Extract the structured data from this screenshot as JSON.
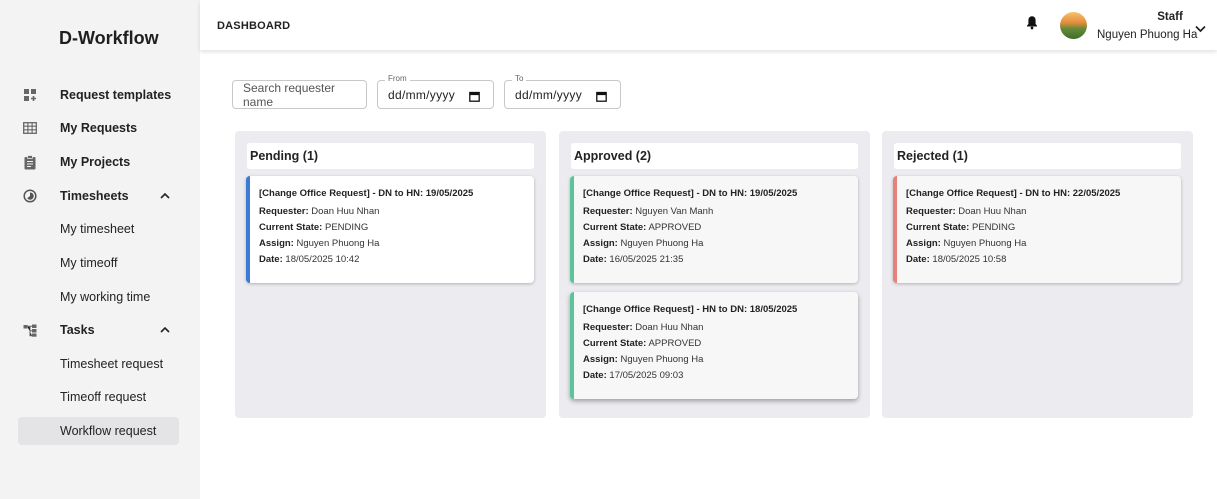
{
  "sidebar": {
    "brand": "D-Workflow",
    "items": [
      {
        "label": "Request templates"
      },
      {
        "label": "My Requests"
      },
      {
        "label": "My Projects"
      },
      {
        "label": "Timesheets"
      },
      {
        "label": "My timesheet"
      },
      {
        "label": "My timeoff"
      },
      {
        "label": "My working time"
      },
      {
        "label": "Tasks"
      },
      {
        "label": "Timesheet request"
      },
      {
        "label": "Timeoff request"
      },
      {
        "label": "Workflow request"
      }
    ]
  },
  "header": {
    "title": "DASHBOARD",
    "role": "Staff",
    "user_name": "Nguyen Phuong Ha"
  },
  "filters": {
    "search_placeholder": "Search requester name",
    "from_label": "From",
    "from_value": "dd/mm/yyyy",
    "to_label": "To",
    "to_value": "dd/mm/yyyy"
  },
  "labels": {
    "requester": "Requester:",
    "state": "Current State:",
    "assign": "Assign:",
    "date": "Date:"
  },
  "colors": {
    "pending": "#3a7bd5",
    "approved": "#5cc49a",
    "rejected": "#e8807a"
  },
  "columns": [
    {
      "title": "Pending (1)",
      "cards": [
        {
          "title": "[Change Office Request] - DN to HN: 19/05/2025",
          "requester": "Doan Huu Nhan",
          "state": "PENDING",
          "assign": "Nguyen Phuong Ha",
          "date": "18/05/2025 10:42"
        }
      ]
    },
    {
      "title": "Approved (2)",
      "cards": [
        {
          "title": "[Change Office Request] - DN to HN: 19/05/2025",
          "requester": "Nguyen Van Manh",
          "state": "APPROVED",
          "assign": "Nguyen Phuong Ha",
          "date": "16/05/2025 21:35"
        },
        {
          "title": "[Change Office Request] - HN to DN: 18/05/2025",
          "requester": "Doan Huu Nhan",
          "state": "APPROVED",
          "assign": "Nguyen Phuong Ha",
          "date": "17/05/2025 09:03"
        }
      ]
    },
    {
      "title": "Rejected (1)",
      "cards": [
        {
          "title": "[Change Office Request] - DN to HN: 22/05/2025",
          "requester": "Doan Huu Nhan",
          "state": "PENDING",
          "assign": "Nguyen Phuong Ha",
          "date": "18/05/2025 10:58"
        }
      ]
    }
  ]
}
